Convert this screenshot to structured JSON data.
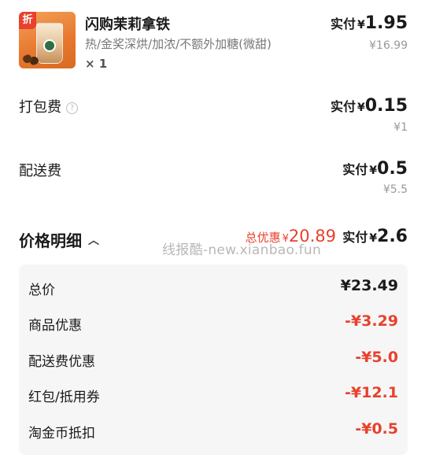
{
  "product": {
    "badge": "折",
    "name": "闪购茉莉拿铁",
    "spec": "热/金奖深烘/加浓/不额外加糖(微甜)",
    "qty": "× 1",
    "paid_label": "实付",
    "currency": "¥",
    "paid_amount": "1.95",
    "original_price": "¥16.99"
  },
  "packing_fee": {
    "label": "打包费",
    "help_icon": "?",
    "paid_label": "实付",
    "currency": "¥",
    "paid_amount": "0.15",
    "original_price": "¥1"
  },
  "delivery_fee": {
    "label": "配送费",
    "paid_label": "实付",
    "currency": "¥",
    "paid_amount": "0.5",
    "original_price": "¥5.5"
  },
  "price_detail": {
    "title": "价格明细",
    "chevron": "︿",
    "total_discount_label": "总优惠",
    "total_discount_currency": "¥",
    "total_discount_amount": "20.89",
    "paid_label": "实付",
    "currency": "¥",
    "paid_amount": "2.6",
    "watermark": "线报酷-new.xianbao.fun",
    "rows": [
      {
        "label": "总价",
        "value": "¥23.49"
      },
      {
        "label": "商品优惠",
        "value": "-¥3.29"
      },
      {
        "label": "配送费优惠",
        "value": "-¥5.0"
      },
      {
        "label": "红包/抵用券",
        "value": "-¥12.1"
      },
      {
        "label": "淘金币抵扣",
        "value": "-¥0.5"
      }
    ]
  },
  "colors": {
    "accent_red": "#e8412e",
    "panel_bg": "#f6f6f6"
  }
}
